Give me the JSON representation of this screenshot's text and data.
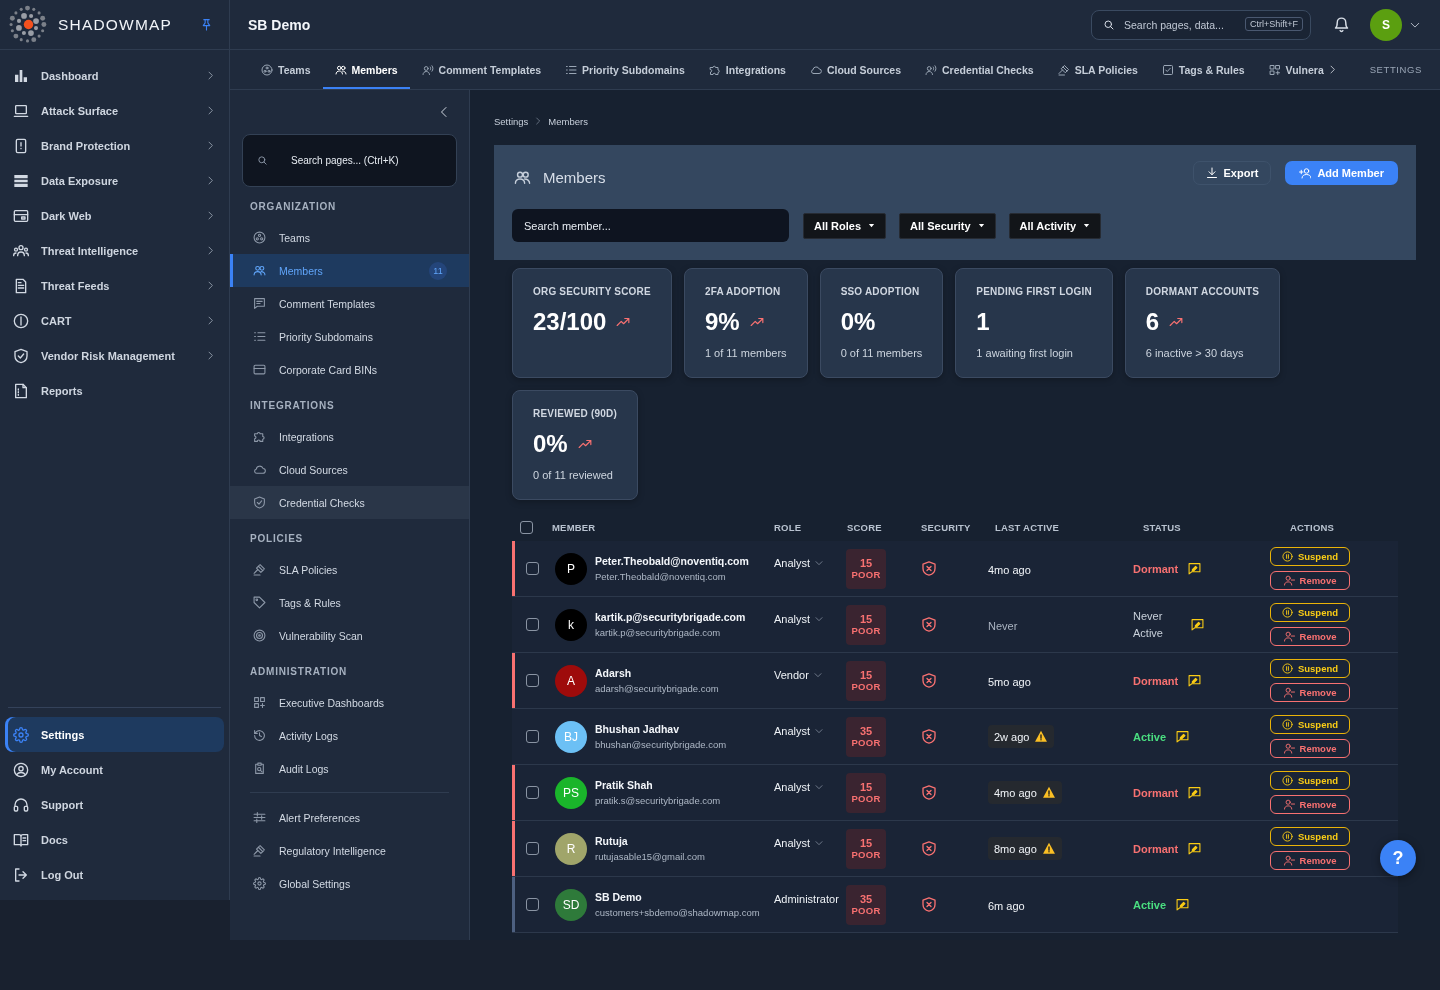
{
  "brand": {
    "name": "SHADOWMAP"
  },
  "nav": {
    "items": [
      {
        "label": "Dashboard",
        "expandable": true,
        "selected": false
      },
      {
        "label": "Attack Surface",
        "expandable": true,
        "selected": false
      },
      {
        "label": "Brand Protection",
        "expandable": true,
        "selected": false
      },
      {
        "label": "Data Exposure",
        "expandable": true,
        "selected": false
      },
      {
        "label": "Dark Web",
        "expandable": true,
        "selected": false
      },
      {
        "label": "Threat Intelligence",
        "expandable": true,
        "selected": false
      },
      {
        "label": "Threat Feeds",
        "expandable": true,
        "selected": false
      },
      {
        "label": "CART",
        "expandable": true,
        "selected": false
      },
      {
        "label": "Vendor Risk Management",
        "expandable": true,
        "selected": false
      },
      {
        "label": "Reports",
        "expandable": false,
        "selected": false
      }
    ],
    "bottom_items": [
      {
        "label": "Settings",
        "selected": true
      },
      {
        "label": "My Account",
        "selected": false
      },
      {
        "label": "Support",
        "selected": false
      },
      {
        "label": "Docs",
        "selected": false
      },
      {
        "label": "Log Out",
        "selected": false
      }
    ]
  },
  "header": {
    "title": "SB Demo",
    "search": {
      "placeholder": "Search pages, data...",
      "shortcut": "Ctrl+Shift+F"
    },
    "avatar": {
      "initial": "S"
    }
  },
  "tabs": {
    "items": [
      {
        "label": "Teams",
        "selected": false
      },
      {
        "label": "Members",
        "selected": true
      },
      {
        "label": "Comment Templates",
        "selected": false
      },
      {
        "label": "Priority Subdomains",
        "selected": false
      },
      {
        "label": "Integrations",
        "selected": false
      },
      {
        "label": "Cloud Sources",
        "selected": false
      },
      {
        "label": "Credential Checks",
        "selected": false
      },
      {
        "label": "SLA Policies",
        "selected": false
      },
      {
        "label": "Tags & Rules",
        "selected": false
      },
      {
        "label": "Vulnera",
        "selected": false
      }
    ],
    "section_label": "SETTINGS"
  },
  "settings_nav": {
    "search": {
      "placeholder": "Search pages... (Ctrl+K)"
    },
    "groups": [
      {
        "title": "ORGANIZATION",
        "items": [
          {
            "label": "Teams",
            "selected": false,
            "hovered": false
          },
          {
            "label": "Members",
            "selected": true,
            "hovered": false,
            "badge": "11"
          },
          {
            "label": "Comment Templates",
            "selected": false,
            "hovered": false
          },
          {
            "label": "Priority Subdomains",
            "selected": false,
            "hovered": false
          },
          {
            "label": "Corporate Card BINs",
            "selected": false,
            "hovered": false
          }
        ]
      },
      {
        "title": "INTEGRATIONS",
        "items": [
          {
            "label": "Integrations",
            "selected": false,
            "hovered": false
          },
          {
            "label": "Cloud Sources",
            "selected": false,
            "hovered": false
          },
          {
            "label": "Credential Checks",
            "selected": false,
            "hovered": true
          }
        ]
      },
      {
        "title": "POLICIES",
        "items": [
          {
            "label": "SLA Policies",
            "selected": false,
            "hovered": false
          },
          {
            "label": "Tags & Rules",
            "selected": false,
            "hovered": false
          },
          {
            "label": "Vulnerability Scan",
            "selected": false,
            "hovered": false
          }
        ]
      },
      {
        "title": "ADMINISTRATION",
        "items": [
          {
            "label": "Executive Dashboards",
            "selected": false,
            "hovered": false
          },
          {
            "label": "Activity Logs",
            "selected": false,
            "hovered": false
          },
          {
            "label": "Audit Logs",
            "selected": false,
            "hovered": false
          }
        ]
      },
      {
        "items": [
          {
            "label": "Alert Preferences",
            "selected": false,
            "hovered": false
          },
          {
            "label": "Regulatory Intelligence",
            "selected": false,
            "hovered": false
          },
          {
            "label": "Global Settings",
            "selected": false,
            "hovered": false
          }
        ]
      }
    ]
  },
  "breadcrumb": [
    "Settings",
    "Members"
  ],
  "panel": {
    "title": "Members",
    "buttons": [
      {
        "label": "Export",
        "kind": "export"
      },
      {
        "label": "Add Member",
        "kind": "add"
      }
    ],
    "search": {
      "placeholder": "Search member..."
    },
    "filters": [
      "All Roles",
      "All Security",
      "All Activity"
    ]
  },
  "stats": [
    {
      "label": "ORG SECURITY SCORE",
      "value": "23/100",
      "trend": true
    },
    {
      "label": "2FA ADOPTION",
      "value": "9%",
      "trend": true,
      "note": "1 of 11 members"
    },
    {
      "label": "SSO ADOPTION",
      "value": "0%",
      "trend": false,
      "note": "0 of 11 members"
    },
    {
      "label": "PENDING FIRST LOGIN",
      "value": "1",
      "trend": false,
      "note": "1 awaiting first login"
    },
    {
      "label": "DORMANT ACCOUNTS",
      "value": "6",
      "trend": true,
      "note": "6 inactive > 30 days"
    },
    {
      "label": "REVIEWED (90D)",
      "value": "0%",
      "trend": true,
      "note": "0 of 11 reviewed"
    }
  ],
  "table": {
    "select_all": {
      "checked": false
    },
    "columns": [
      "MEMBER",
      "ROLE",
      "SCORE",
      "SECURITY",
      "LAST ACTIVE",
      "STATUS",
      "ACTIONS"
    ],
    "rows": [
      {
        "checked": false,
        "flagged": true,
        "current_user": false,
        "initials": "P",
        "color": "#000000",
        "name": "Peter.Theobald@noventiq.com",
        "email": "Peter.Theobald@noventiq.com",
        "role": "Analyst",
        "role_dropdown": true,
        "score": "15",
        "grade": "POOR",
        "last_active": {
          "text": "4mo ago",
          "warning": false,
          "muted": false
        },
        "status": {
          "label": "Dormant",
          "kind": "dormant"
        },
        "actions": [
          {
            "label": "Suspend",
            "kind": "suspend"
          },
          {
            "label": "Remove",
            "kind": "remove"
          }
        ]
      },
      {
        "checked": false,
        "flagged": false,
        "current_user": false,
        "initials": "k",
        "color": "#000000",
        "name": "kartik.p@securitybrigade.com",
        "email": "kartik.p@securitybrigade.com",
        "role": "Analyst",
        "role_dropdown": true,
        "score": "15",
        "grade": "POOR",
        "last_active": {
          "text": "Never",
          "warning": false,
          "muted": true
        },
        "status": {
          "label": "Never Active",
          "kind": "never"
        },
        "actions": [
          {
            "label": "Suspend",
            "kind": "suspend"
          },
          {
            "label": "Remove",
            "kind": "remove"
          }
        ]
      },
      {
        "checked": false,
        "flagged": true,
        "current_user": false,
        "initials": "A",
        "color": "#9e0b0b",
        "name": "Adarsh",
        "email": "adarsh@securitybrigade.com",
        "role": "Vendor",
        "role_dropdown": true,
        "score": "15",
        "grade": "POOR",
        "last_active": {
          "text": "5mo ago",
          "warning": false,
          "muted": false
        },
        "status": {
          "label": "Dormant",
          "kind": "dormant"
        },
        "actions": [
          {
            "label": "Suspend",
            "kind": "suspend"
          },
          {
            "label": "Remove",
            "kind": "remove"
          }
        ]
      },
      {
        "checked": false,
        "flagged": false,
        "current_user": false,
        "initials": "BJ",
        "color": "#6cc0f5",
        "name": "Bhushan Jadhav",
        "email": "bhushan@securitybrigade.com",
        "role": "Analyst",
        "role_dropdown": true,
        "score": "35",
        "grade": "POOR",
        "last_active": {
          "text": "2w ago",
          "warning": true,
          "muted": false
        },
        "status": {
          "label": "Active",
          "kind": "active"
        },
        "actions": [
          {
            "label": "Suspend",
            "kind": "suspend"
          },
          {
            "label": "Remove",
            "kind": "remove"
          }
        ]
      },
      {
        "checked": false,
        "flagged": true,
        "current_user": false,
        "initials": "PS",
        "color": "#1ab52b",
        "name": "Pratik Shah",
        "email": "pratik.s@securitybrigade.com",
        "role": "Analyst",
        "role_dropdown": true,
        "score": "15",
        "grade": "POOR",
        "last_active": {
          "text": "4mo ago",
          "warning": true,
          "muted": false
        },
        "status": {
          "label": "Dormant",
          "kind": "dormant"
        },
        "actions": [
          {
            "label": "Suspend",
            "kind": "suspend"
          },
          {
            "label": "Remove",
            "kind": "remove"
          }
        ]
      },
      {
        "checked": false,
        "flagged": true,
        "current_user": false,
        "initials": "R",
        "color": "#a0a56a",
        "name": "Rutuja",
        "email": "rutujasable15@gmail.com",
        "role": "Analyst",
        "role_dropdown": true,
        "score": "15",
        "grade": "POOR",
        "last_active": {
          "text": "8mo ago",
          "warning": true,
          "muted": false
        },
        "status": {
          "label": "Dormant",
          "kind": "dormant"
        },
        "actions": [
          {
            "label": "Suspend",
            "kind": "suspend"
          },
          {
            "label": "Remove",
            "kind": "remove"
          }
        ]
      },
      {
        "checked": false,
        "flagged": false,
        "current_user": true,
        "initials": "SD",
        "color": "#2e7a3a",
        "name": "SB Demo",
        "email": "customers+sbdemo@shadowmap.com",
        "role": "Administrator",
        "role_dropdown": false,
        "score": "35",
        "grade": "POOR",
        "last_active": {
          "text": "6m ago",
          "warning": false,
          "muted": false
        },
        "status": {
          "label": "Active",
          "kind": "active"
        }
      }
    ]
  },
  "help_button": {
    "label": "?"
  }
}
